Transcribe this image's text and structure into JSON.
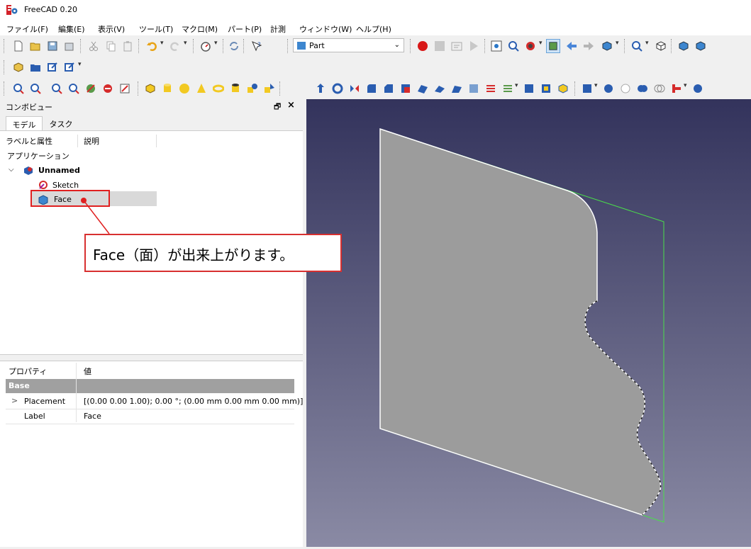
{
  "window": {
    "title": "FreeCAD 0.20"
  },
  "menu": [
    "ファイル(F)",
    "編集(E)",
    "表示(V)",
    "ツール(T)",
    "マクロ(M)",
    "パート(P)",
    "計測",
    "ウィンドウ(W)",
    "ヘルプ(H)"
  ],
  "toolbar": {
    "workbench": "Part"
  },
  "combo_view": {
    "title": "コンボビュー",
    "tabs": [
      "モデル",
      "タスク"
    ],
    "tree_columns": [
      "ラベルと属性",
      "説明"
    ],
    "tree_root": "アプリケーション",
    "document": "Unnamed",
    "children": [
      "Sketch",
      "Face"
    ]
  },
  "properties": {
    "columns": [
      "プロパティ",
      "値"
    ],
    "group": "Base",
    "rows": [
      {
        "name": "Placement",
        "value": "[(0.00 0.00 1.00); 0.00 °; (0.00 mm  0.00 mm  0.00 mm)]"
      },
      {
        "name": "Label",
        "value": "Face"
      }
    ]
  },
  "annotation": {
    "text": "Face（面）が出来上がります。"
  },
  "colors": {
    "accent_red": "#e02020",
    "selection": "#d9d9d9",
    "face_fill": "#9c9c9c",
    "face_edge": "#4ade4a"
  },
  "icons": [
    "freecad-logo-icon",
    "new-file-icon",
    "open-icon",
    "save-icon",
    "cut-icon",
    "copy-icon",
    "paste-icon",
    "undo-icon",
    "redo-icon",
    "refresh-icon",
    "whats-this-icon",
    "record-macro-icon",
    "stop-macro-icon",
    "edit-macro-icon",
    "run-macro-icon",
    "fit-all-icon",
    "fit-selection-icon",
    "draw-style-icon",
    "bounding-box-icon",
    "back-icon",
    "forward-icon",
    "std-views-icon",
    "zoom-icon",
    "cube-view-icon",
    "part-box-icon",
    "part-cylinder-icon",
    "part-sphere-icon",
    "part-cone-icon",
    "part-torus-icon",
    "part-tube-icon",
    "document-icon",
    "sketch-icon",
    "face-icon"
  ]
}
